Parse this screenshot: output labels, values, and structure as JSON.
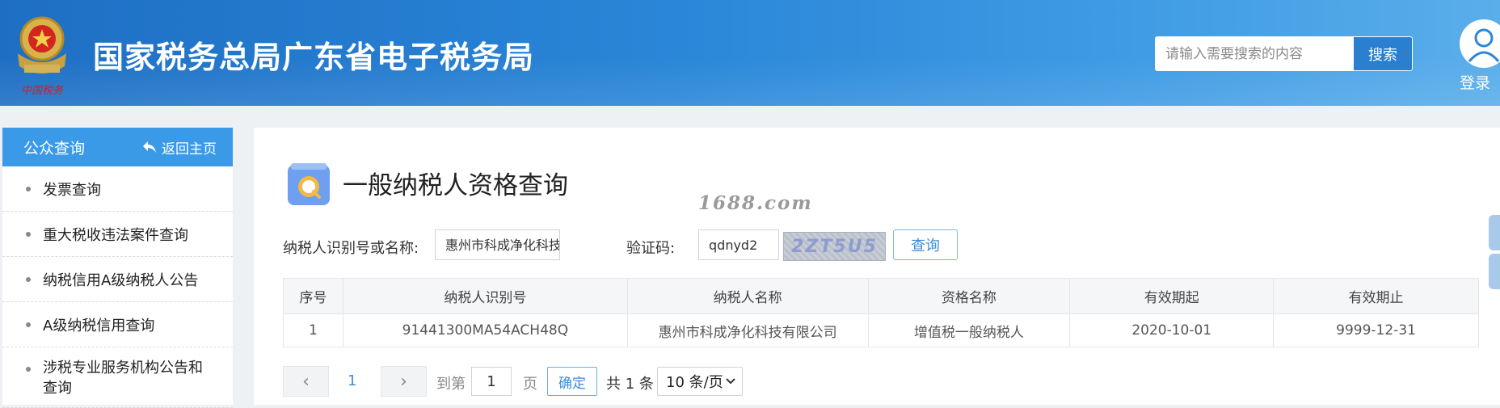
{
  "header": {
    "emblem_caption": "中国税务",
    "title": "国家税务总局广东省电子税务局",
    "search_placeholder": "请输入需要搜索的内容",
    "search_button": "搜索",
    "login_label": "登录"
  },
  "sidebar": {
    "title": "公众查询",
    "back_home": "返回主页",
    "items": [
      {
        "label": "发票查询"
      },
      {
        "label": "重大税收违法案件查询"
      },
      {
        "label": "纳税信用A级纳税人公告"
      },
      {
        "label": "A级纳税信用查询"
      },
      {
        "label": "涉税专业服务机构公告和查询"
      }
    ]
  },
  "main": {
    "page_title": "一般纳税人资格查询",
    "watermark": "1688.com",
    "form": {
      "taxpayer_label": "纳税人识别号或名称:",
      "taxpayer_value": "惠州市科成净化科技有限公司",
      "captcha_label": "验证码:",
      "captcha_value": "qdnyd2",
      "captcha_image_text": "2ZT5U5",
      "query_button": "查询"
    },
    "table": {
      "headers": [
        "序号",
        "纳税人识别号",
        "纳税人名称",
        "资格名称",
        "有效期起",
        "有效期止"
      ],
      "rows": [
        [
          "1",
          "91441300MA54ACH48Q",
          "惠州市科成净化科技有限公司",
          "增值税一般纳税人",
          "2020-10-01",
          "9999-12-31"
        ]
      ]
    },
    "pager": {
      "current_page": "1",
      "goto_label": "到第",
      "goto_value": "1",
      "page_unit": "页",
      "confirm": "确定",
      "total": "共 1 条",
      "page_size": "10 条/页"
    }
  },
  "colors": {
    "header_blue": "#2a86d8",
    "sidebar_head": "#3a9ae8",
    "link_blue": "#3b8ed6"
  }
}
